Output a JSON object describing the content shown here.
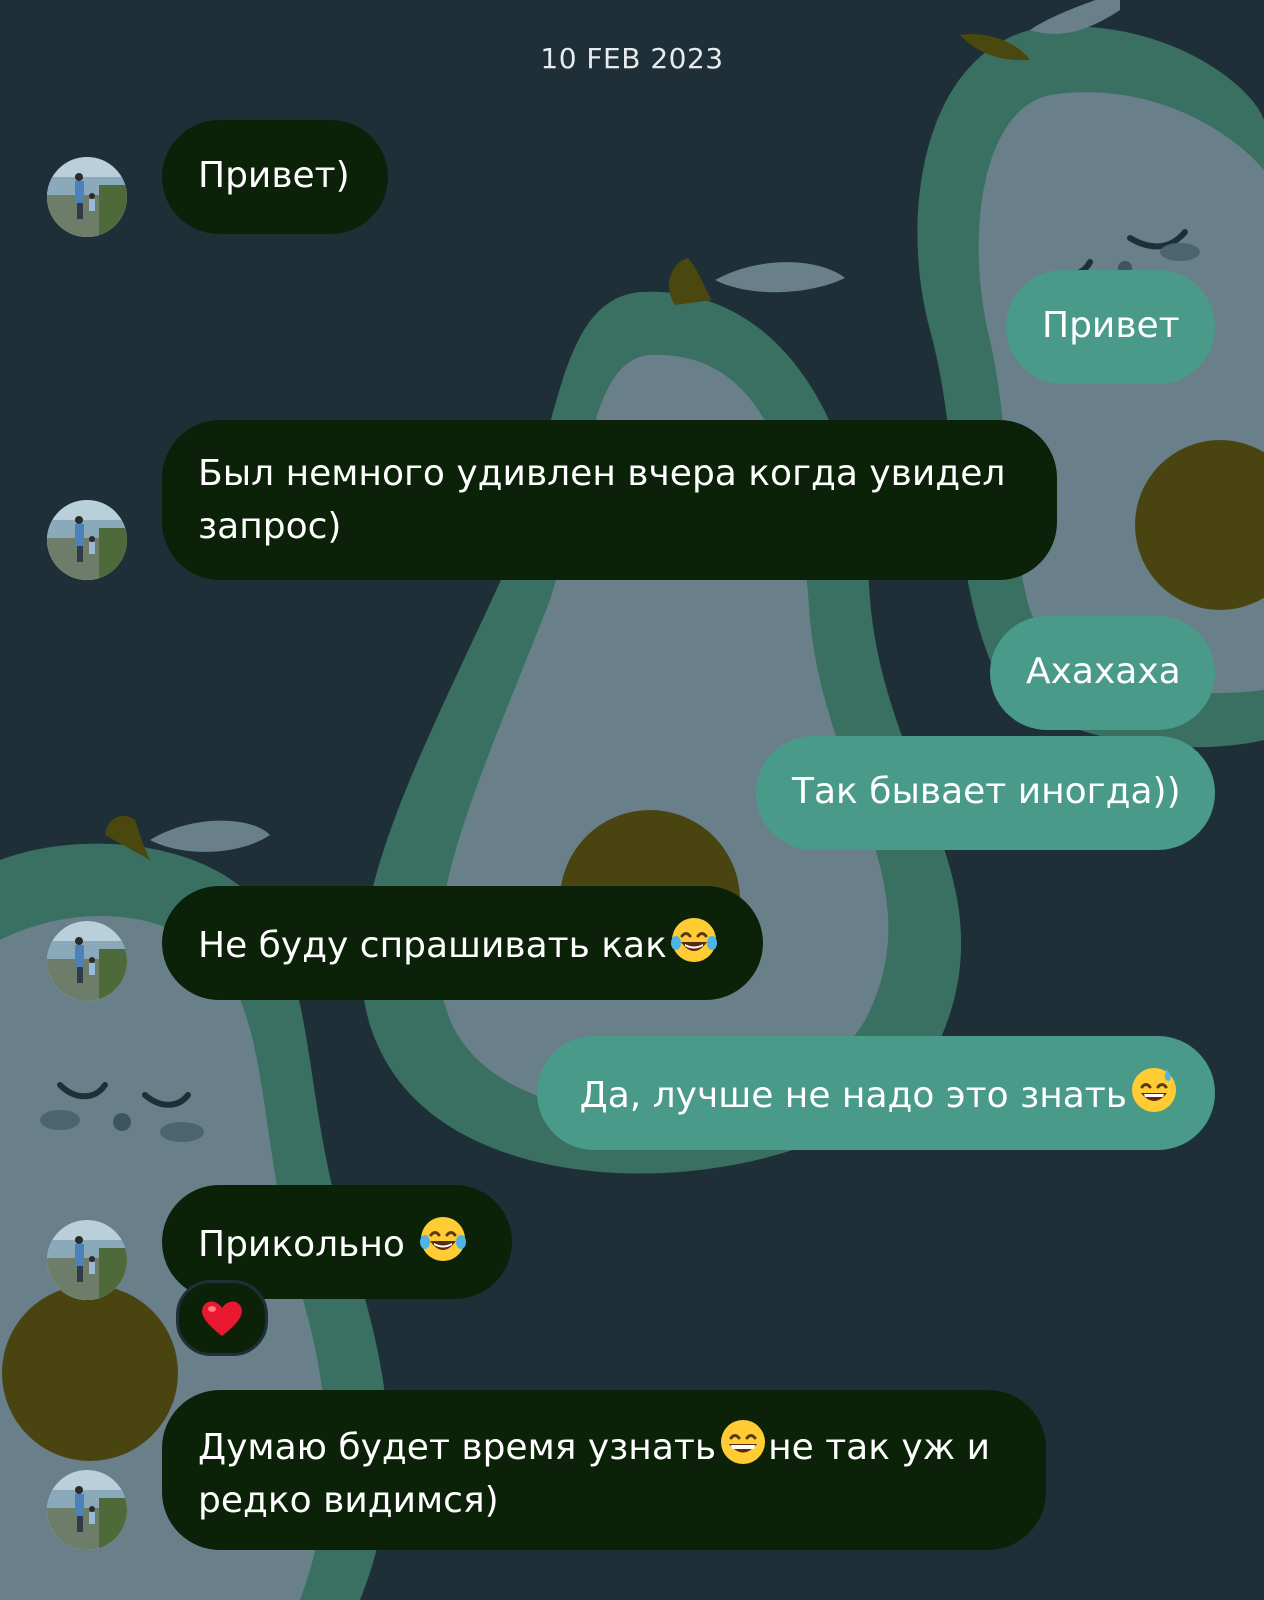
{
  "chat": {
    "date": "10 FEB 2023",
    "messages": [
      {
        "side": "in",
        "text": "Привет)"
      },
      {
        "side": "out",
        "text": "Привет"
      },
      {
        "side": "in",
        "text": "Был немного удивлен вчера когда увидел запрос)"
      },
      {
        "side": "out",
        "text": "Ахахаха"
      },
      {
        "side": "out",
        "text": "Так бывает иногда))"
      },
      {
        "side": "in",
        "text": "Не буду спрашивать как",
        "emoji": "tears-of-joy"
      },
      {
        "side": "out",
        "text": "Да, лучше не надо это знать",
        "emoji": "grinning-sweat"
      },
      {
        "side": "in",
        "text": "Прикольно ",
        "emoji": "tears-of-joy",
        "reaction": "red-heart"
      },
      {
        "side": "in",
        "text_parts": [
          "Думаю будет время узнать",
          "не так уж и редко видимся)"
        ],
        "emoji": "grinning-smile"
      }
    ]
  },
  "colors": {
    "background": "#1f2f38",
    "incoming_bubble": "#0b2209",
    "outgoing_bubble": "#4a9a8a",
    "text": "#ffffff"
  }
}
